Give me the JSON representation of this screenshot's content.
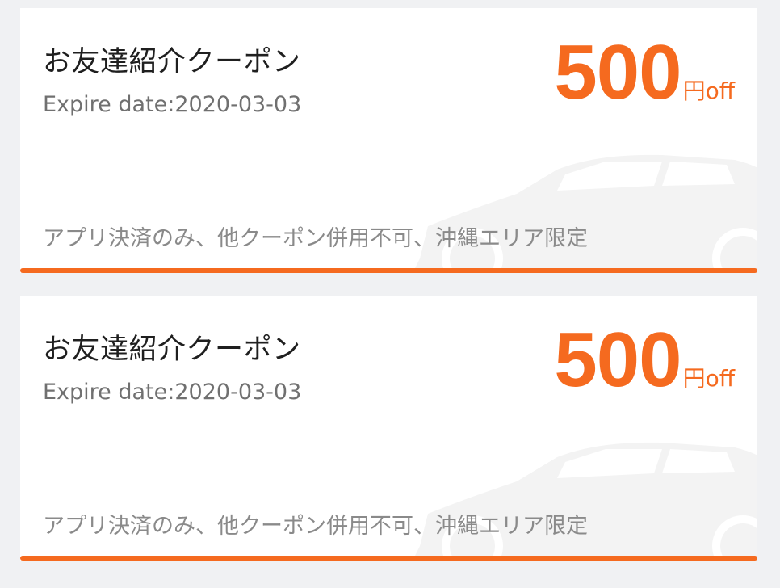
{
  "coupons": [
    {
      "title": "お友達紹介クーポン",
      "expire": "Expire date:2020-03-03",
      "amount": "500",
      "unit": "円off",
      "note": "アプリ決済のみ、他クーポン併用不可、沖縄エリア限定"
    },
    {
      "title": "お友達紹介クーポン",
      "expire": "Expire date:2020-03-03",
      "amount": "500",
      "unit": "円off",
      "note": "アプリ決済のみ、他クーポン併用不可、沖縄エリア限定"
    }
  ],
  "colors": {
    "accent": "#f56a1f",
    "background": "#f0f1f3",
    "card": "#ffffff"
  },
  "icons": {
    "watermark": "car-icon"
  }
}
